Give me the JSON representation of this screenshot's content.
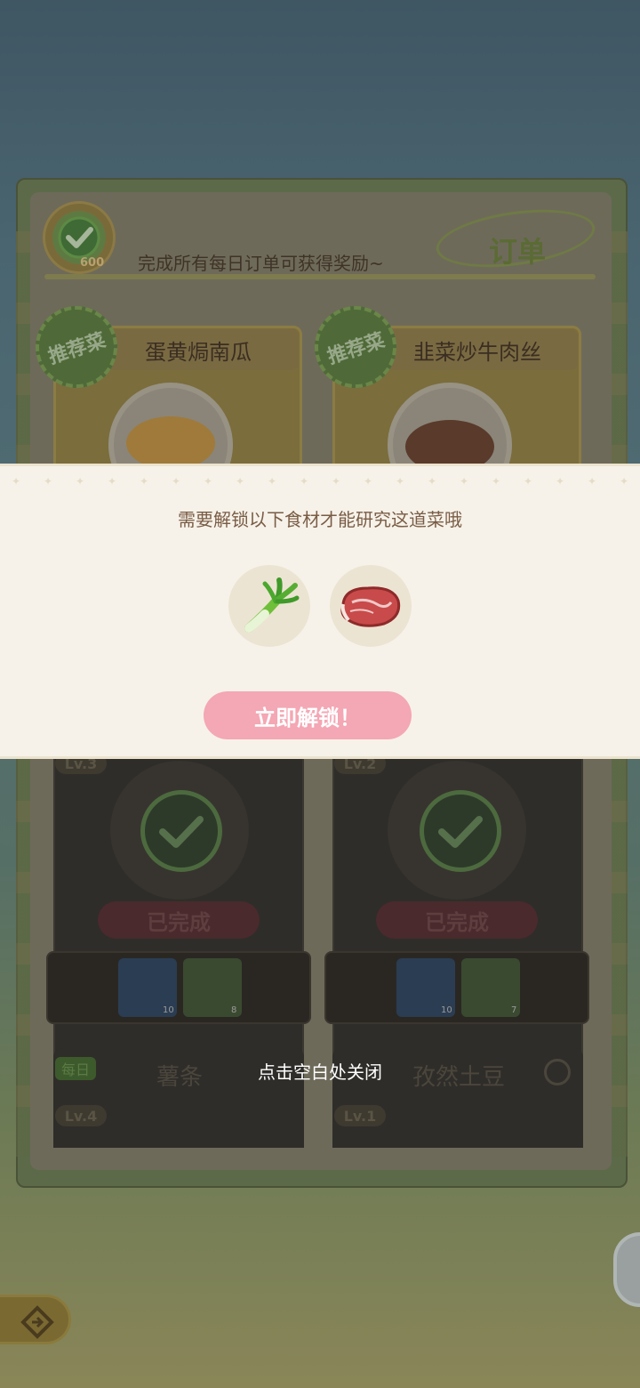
{
  "board": {
    "medal_count": "600",
    "reward_text": "完成所有每日订单可获得奖励~",
    "title": "订单",
    "recommend_badge": "推荐菜",
    "dishes": [
      {
        "name": "蛋黄焗南瓜"
      },
      {
        "name": "韭菜炒牛肉丝"
      }
    ],
    "completed_orders": [
      {
        "level": "Lv.3",
        "status": "已完成",
        "rewards": [
          {
            "icon": "snowflake-icon",
            "count": "10"
          },
          {
            "icon": "orange-clock-icon",
            "count": "8"
          }
        ]
      },
      {
        "level": "Lv.2",
        "status": "已完成",
        "rewards": [
          {
            "icon": "snowflake-icon",
            "count": "10"
          },
          {
            "icon": "orange-clock-icon",
            "count": "7"
          }
        ]
      }
    ],
    "bottom_orders": [
      {
        "tag": "每日",
        "name": "薯条",
        "level": "Lv.4"
      },
      {
        "name": "孜然土豆",
        "level": "Lv.1"
      }
    ]
  },
  "modal": {
    "message": "需要解锁以下食材才能研究这道菜哦",
    "ingredients": [
      {
        "icon": "leek-icon"
      },
      {
        "icon": "beef-icon"
      }
    ],
    "unlock_button": "立即解锁！",
    "close_hint": "点击空白处关闭"
  },
  "colors": {
    "banner_bg": "#f6f2e9",
    "button_pink": "#f4a7b4",
    "message_text": "#7a5c45"
  }
}
